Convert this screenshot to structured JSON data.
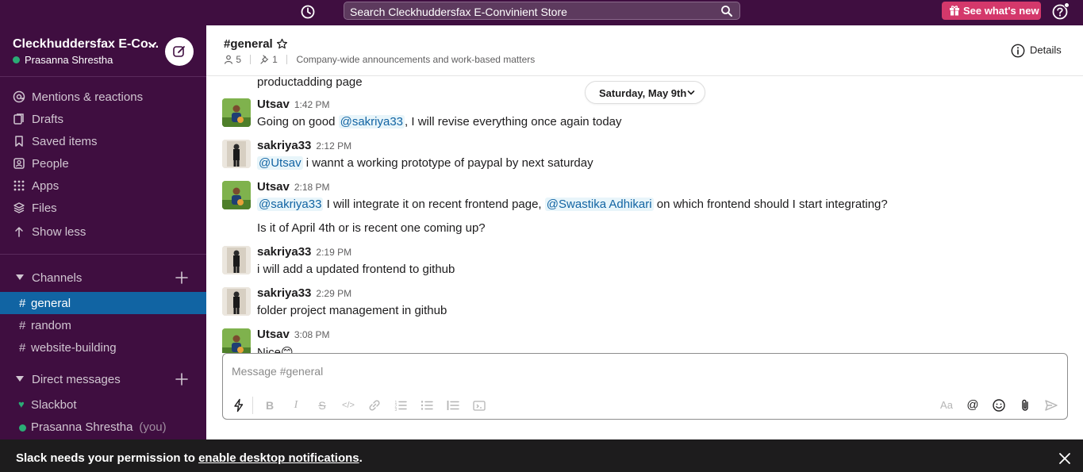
{
  "topbar": {
    "search_text": "Search Cleckhuddersfax E-Convinient Store",
    "whats_new_label": "See what's new"
  },
  "sidebar": {
    "workspace_name": "Cleckhuddersfax E-Co...",
    "user_name": "Prasanna Shrestha",
    "nav_items": [
      {
        "label": "Mentions & reactions",
        "icon": "at-icon"
      },
      {
        "label": "Drafts",
        "icon": "drafts-icon"
      },
      {
        "label": "Saved items",
        "icon": "bookmark-icon"
      },
      {
        "label": "People",
        "icon": "people-icon"
      },
      {
        "label": "Apps",
        "icon": "apps-grid-icon"
      },
      {
        "label": "Files",
        "icon": "files-stack-icon"
      },
      {
        "label": "Show less",
        "icon": "arrow-up-icon"
      }
    ],
    "channels_label": "Channels",
    "channels": [
      "general",
      "random",
      "website-building"
    ],
    "active_channel": "general",
    "dms_label": "Direct messages",
    "dms": [
      {
        "name": "Slackbot",
        "status": "heart"
      },
      {
        "name": "Prasanna Shrestha",
        "suffix": "(you)",
        "status": "online"
      }
    ]
  },
  "channel_header": {
    "title": "#general",
    "members": "5",
    "pins": "1",
    "description": "Company-wide announcements and work-based matters",
    "details_label": "Details"
  },
  "messages": {
    "date_divider": "Saturday, May 9th",
    "partial_top": "productadding page",
    "items": [
      {
        "author": "Utsav",
        "time": "1:42 PM",
        "pre": "Going on good ",
        "mention": "@sakriya33",
        "post": ", I will revise everything once again today"
      },
      {
        "author": "sakriya33",
        "time": "2:12 PM",
        "mention": "@Utsav",
        "post": " i wannt a working prototype of paypal by next saturday"
      },
      {
        "author": "Utsav",
        "time": "2:18 PM",
        "mention": "@sakriya33",
        "mid": " I will integrate it on recent frontend page, ",
        "mention2": "@Swastika Adhikari",
        "post": " on which frontend should I start integrating?",
        "followup": "Is it of April 4th or is recent one coming up?"
      },
      {
        "author": "sakriya33",
        "time": "2:19 PM",
        "text": "i will add a updated frontend to github"
      },
      {
        "author": "sakriya33",
        "time": "2:29 PM",
        "text": "folder project management in github"
      },
      {
        "author": "Utsav",
        "time": "3:08 PM",
        "text": "Nice😊"
      }
    ]
  },
  "composer": {
    "placeholder": "Message #general"
  },
  "banner": {
    "prefix": "Slack needs your permission to ",
    "link": "enable desktop notifications",
    "suffix": "."
  }
}
